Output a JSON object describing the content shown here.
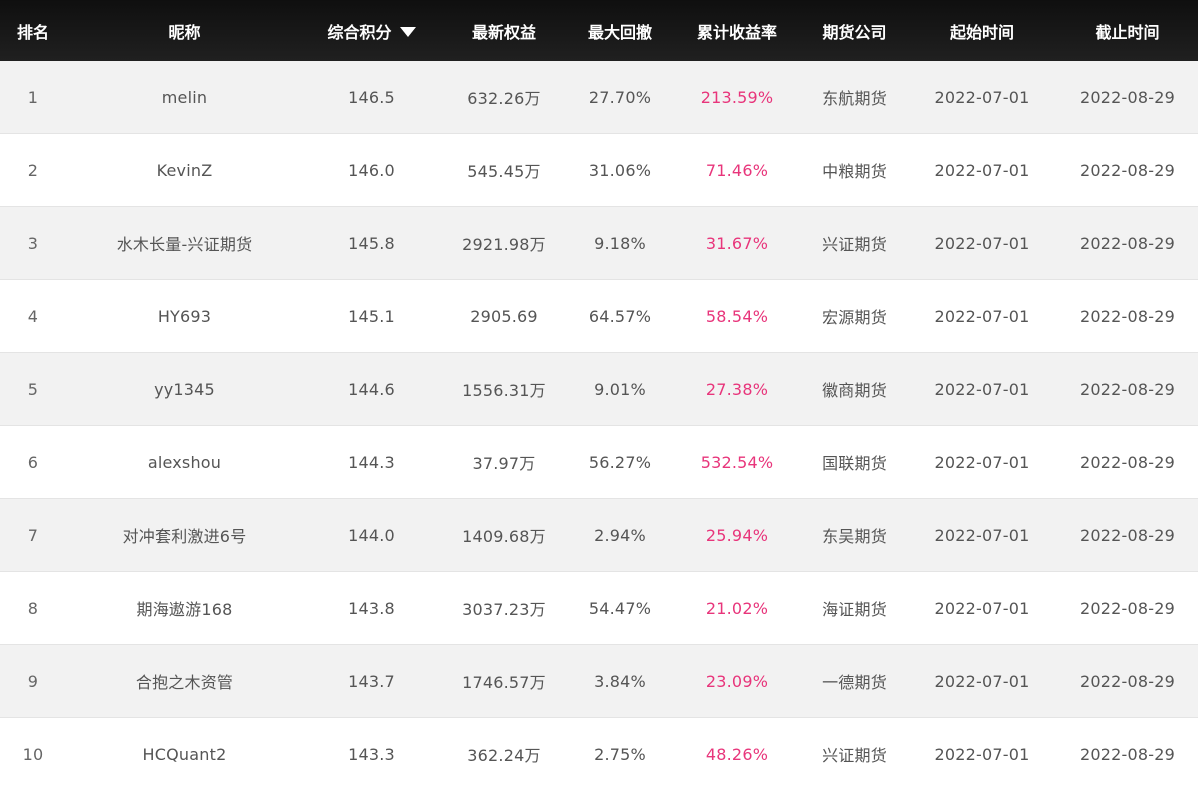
{
  "colors": {
    "header_bg": "#141414",
    "row_alt_bg": "#f2f2f2",
    "return_text": "#e8357b"
  },
  "headers": {
    "rank": "排名",
    "nickname": "昵称",
    "score": "综合积分",
    "score_sort_icon": "triangle-down-icon",
    "equity": "最新权益",
    "drawdown": "最大回撤",
    "return": "累计收益率",
    "company": "期货公司",
    "start": "起始时间",
    "end": "截止时间"
  },
  "rows": [
    {
      "rank": "1",
      "nickname": "melin",
      "score": "146.5",
      "equity": "632.26万",
      "drawdown": "27.70%",
      "return": "213.59%",
      "company": "东航期货",
      "start": "2022-07-01",
      "end": "2022-08-29"
    },
    {
      "rank": "2",
      "nickname": "KevinZ",
      "score": "146.0",
      "equity": "545.45万",
      "drawdown": "31.06%",
      "return": "71.46%",
      "company": "中粮期货",
      "start": "2022-07-01",
      "end": "2022-08-29"
    },
    {
      "rank": "3",
      "nickname": "水木长量-兴证期货",
      "score": "145.8",
      "equity": "2921.98万",
      "drawdown": "9.18%",
      "return": "31.67%",
      "company": "兴证期货",
      "start": "2022-07-01",
      "end": "2022-08-29"
    },
    {
      "rank": "4",
      "nickname": "HY693",
      "score": "145.1",
      "equity": "2905.69",
      "drawdown": "64.57%",
      "return": "58.54%",
      "company": "宏源期货",
      "start": "2022-07-01",
      "end": "2022-08-29"
    },
    {
      "rank": "5",
      "nickname": "yy1345",
      "score": "144.6",
      "equity": "1556.31万",
      "drawdown": "9.01%",
      "return": "27.38%",
      "company": "徽商期货",
      "start": "2022-07-01",
      "end": "2022-08-29"
    },
    {
      "rank": "6",
      "nickname": "alexshou",
      "score": "144.3",
      "equity": "37.97万",
      "drawdown": "56.27%",
      "return": "532.54%",
      "company": "国联期货",
      "start": "2022-07-01",
      "end": "2022-08-29"
    },
    {
      "rank": "7",
      "nickname": "对冲套利激进6号",
      "score": "144.0",
      "equity": "1409.68万",
      "drawdown": "2.94%",
      "return": "25.94%",
      "company": "东吴期货",
      "start": "2022-07-01",
      "end": "2022-08-29"
    },
    {
      "rank": "8",
      "nickname": "期海遨游168",
      "score": "143.8",
      "equity": "3037.23万",
      "drawdown": "54.47%",
      "return": "21.02%",
      "company": "海证期货",
      "start": "2022-07-01",
      "end": "2022-08-29"
    },
    {
      "rank": "9",
      "nickname": "合抱之木资管",
      "score": "143.7",
      "equity": "1746.57万",
      "drawdown": "3.84%",
      "return": "23.09%",
      "company": "一德期货",
      "start": "2022-07-01",
      "end": "2022-08-29"
    },
    {
      "rank": "10",
      "nickname": "HCQuant2",
      "score": "143.3",
      "equity": "362.24万",
      "drawdown": "2.75%",
      "return": "48.26%",
      "company": "兴证期货",
      "start": "2022-07-01",
      "end": "2022-08-29"
    }
  ]
}
